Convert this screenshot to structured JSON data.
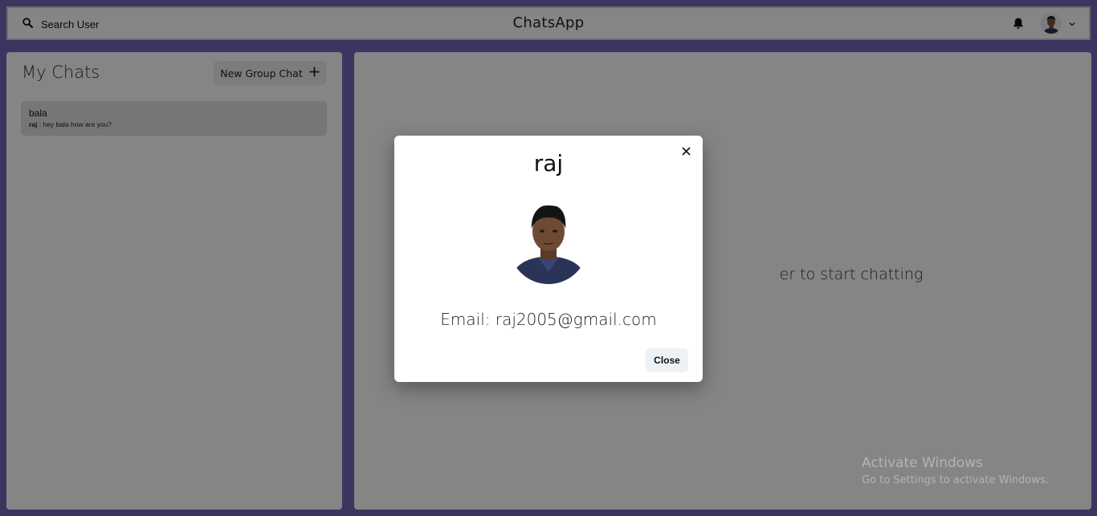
{
  "header": {
    "search_label": "Search User",
    "app_title": "ChatsApp",
    "icons": [
      "search-icon",
      "bell-icon",
      "avatar",
      "chevron-down-icon"
    ]
  },
  "sidebar": {
    "title": "My Chats",
    "new_group_label": "New Group Chat",
    "chats": [
      {
        "name": "bala",
        "sender": "raj",
        "preview": "hey bala how are you?"
      }
    ]
  },
  "main": {
    "placeholder": "er to start chatting"
  },
  "modal": {
    "title": "raj",
    "email": "Email: raj2005@gmail.com",
    "close_label": "Close"
  },
  "watermark": {
    "line1": "Activate Windows",
    "line2": "Go to Settings to activate Windows."
  },
  "colors": {
    "background": "#6f68b6",
    "overlay": "rgba(0,0,0,0.48)",
    "panel": "#ffffff",
    "chat_item": "#e2e2e2",
    "close_button": "#edf2f7"
  }
}
